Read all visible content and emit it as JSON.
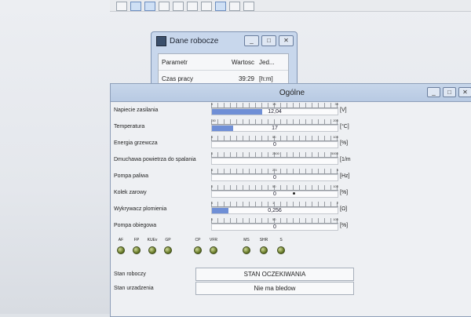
{
  "mini_window": {
    "title": "Dane robocze",
    "btn_min": "_",
    "btn_max": "□",
    "btn_close": "✕",
    "header": {
      "c1": "Parametr",
      "c2": "Wartosc",
      "c3": "Jed..."
    },
    "row": {
      "c1": "Czas pracy",
      "c2": "39:29",
      "c3": "[h:m]"
    }
  },
  "main_window": {
    "title": "Ogólne",
    "btn_min": "_",
    "btn_max": "□",
    "btn_close": "✕"
  },
  "gauges": [
    {
      "label": "Napiecie zasilania",
      "value": "12,04",
      "unit": "[V]",
      "fill": 0.4,
      "ticks": [
        "0",
        "15",
        "30"
      ]
    },
    {
      "label": "Temperatura",
      "value": "17",
      "unit": "[°C]",
      "fill": 0.17,
      "ticks": [
        "-50",
        "",
        "200"
      ]
    },
    {
      "label": "Energia grzewcza",
      "value": "0",
      "unit": "[%]",
      "fill": 0,
      "ticks": [
        "0",
        "50",
        "100"
      ]
    },
    {
      "label": "Dmuchawa powietrza do spalania",
      "value": "",
      "unit": "[1/m",
      "fill": 0,
      "ticks": [
        "0",
        "2500",
        "5000"
      ]
    },
    {
      "label": "Pompa paliwa",
      "value": "0",
      "unit": "[Hz]",
      "fill": 0,
      "ticks": [
        "0",
        "2.5",
        "5"
      ]
    },
    {
      "label": "Kolek zarowy",
      "value": "0",
      "unit": "[%]",
      "fill": 0,
      "ticks": [
        "0",
        "50",
        "100"
      ]
    },
    {
      "label": "Wykrywacz plomienia",
      "value": "0,256",
      "unit": "[Ω]",
      "fill": 0.13,
      "ticks": [
        "0",
        "1",
        "2"
      ]
    },
    {
      "label": "Pompa obiegowa",
      "value": "0",
      "unit": "[%]",
      "fill": 0,
      "ticks": [
        "0",
        "50",
        "100"
      ]
    }
  ],
  "leds": [
    "AF",
    "FP",
    "KUEv",
    "GP",
    "CP",
    "VFR",
    "MS",
    "SHR",
    "S"
  ],
  "status": {
    "stan_label": "Stan roboczy",
    "stan_value": "STAN OCZEKIWANIA",
    "urz_label": "Stan urzadzenia",
    "urz_value": "Nie ma bledow"
  }
}
